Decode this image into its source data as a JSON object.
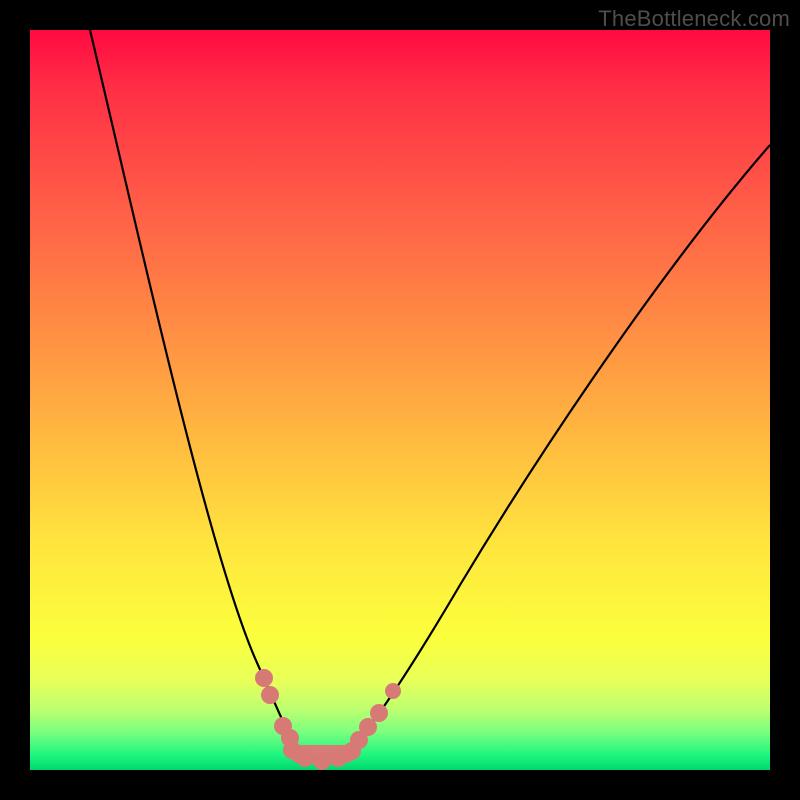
{
  "watermark": "TheBottleneck.com",
  "chart_data": {
    "type": "line",
    "title": "",
    "xlabel": "",
    "ylabel": "",
    "xlim": [
      0,
      100
    ],
    "ylim": [
      0,
      100
    ],
    "background_gradient_meaning": "top = bad (red), bottom = optimal (green)",
    "series": [
      {
        "name": "left-curve",
        "x": [
          8,
          12,
          18,
          24,
          29,
          32,
          34,
          35,
          36
        ],
        "y": [
          100,
          82,
          58,
          36,
          18,
          10,
          5,
          3,
          2
        ]
      },
      {
        "name": "right-curve",
        "x": [
          43,
          46,
          50,
          58,
          66,
          78,
          90,
          100
        ],
        "y": [
          2,
          5,
          10,
          25,
          40,
          60,
          77,
          85
        ]
      }
    ],
    "markers": {
      "name": "highlighted-points",
      "color": "#d77a76",
      "points_xy": [
        [
          31.6,
          12.4
        ],
        [
          32.4,
          10.1
        ],
        [
          34.2,
          6.0
        ],
        [
          35.1,
          4.3
        ],
        [
          35.4,
          2.7
        ],
        [
          37.2,
          1.6
        ],
        [
          39.5,
          1.2
        ],
        [
          41.6,
          1.6
        ],
        [
          43.1,
          2.6
        ],
        [
          44.5,
          4.1
        ],
        [
          45.7,
          5.8
        ],
        [
          47.2,
          7.7
        ],
        [
          49.1,
          10.7
        ]
      ]
    },
    "optimal_zone_x": [
      35,
      43
    ]
  }
}
